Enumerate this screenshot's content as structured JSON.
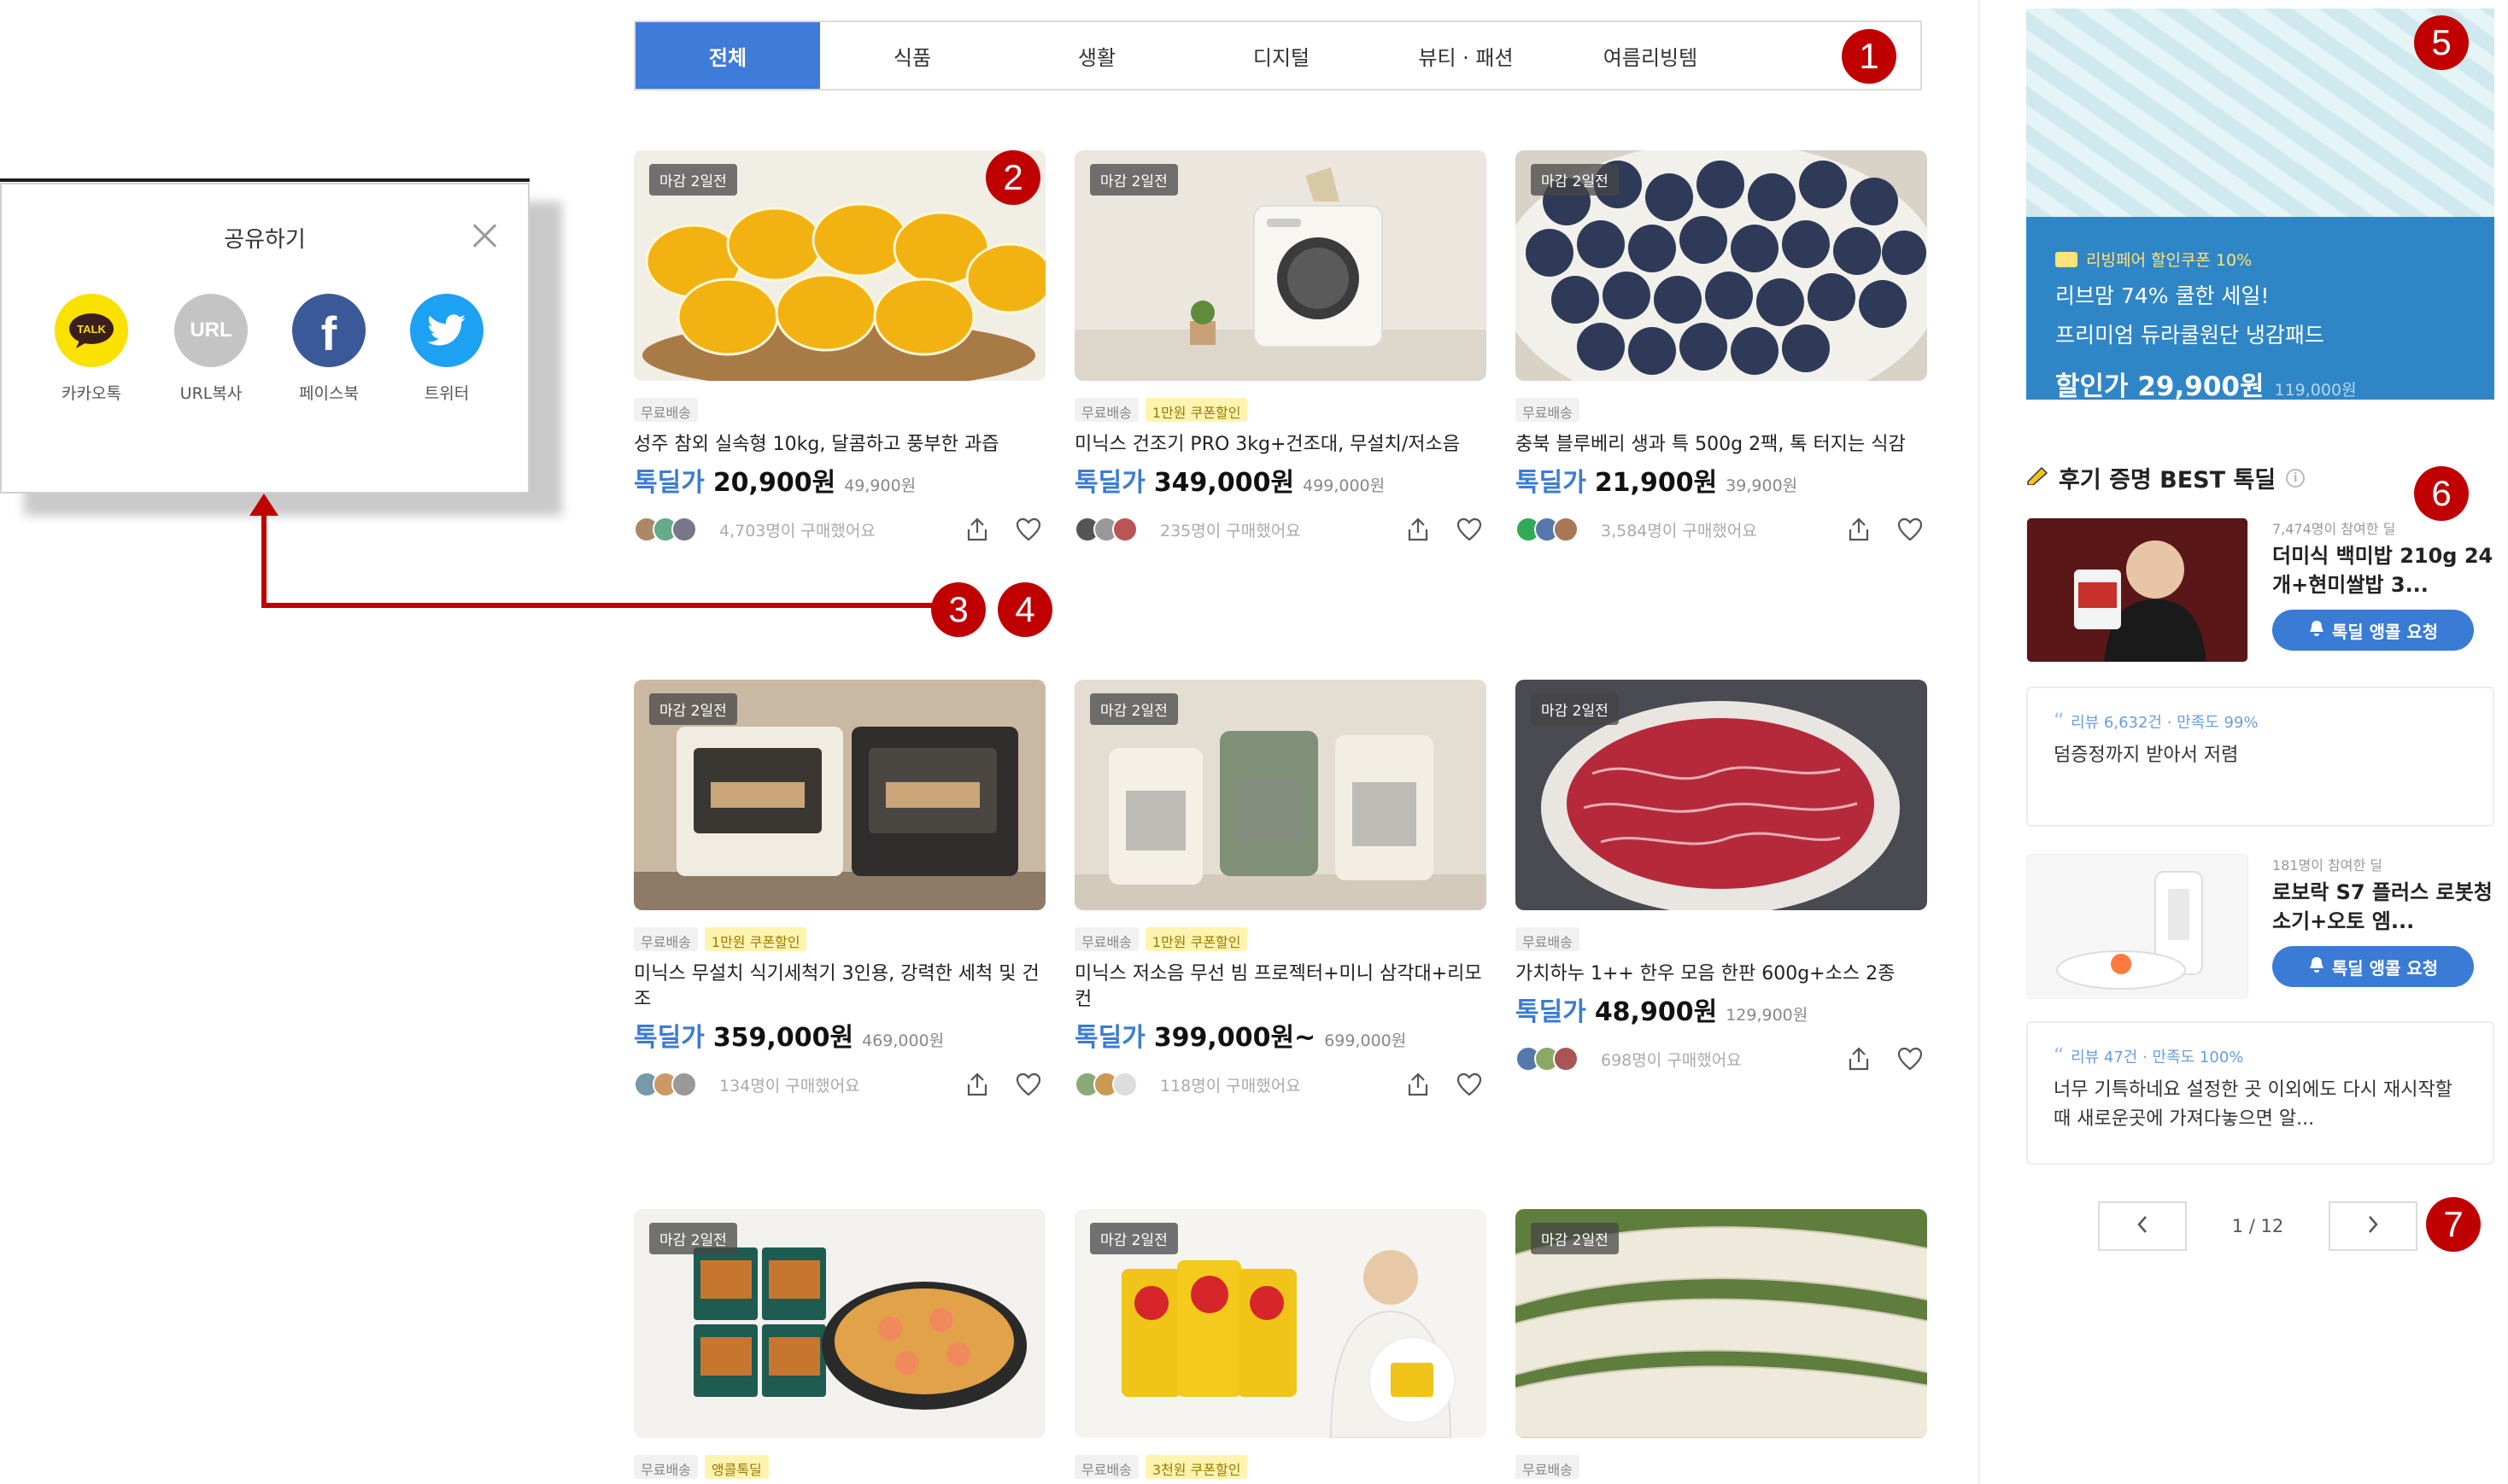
{
  "tabs": [
    {
      "label": "전체",
      "active": true
    },
    {
      "label": "식품",
      "active": false
    },
    {
      "label": "생활",
      "active": false
    },
    {
      "label": "디지털",
      "active": false
    },
    {
      "label": "뷰티 · 패션",
      "active": false
    },
    {
      "label": "여름리빙템",
      "active": false
    }
  ],
  "share": {
    "title": "공유하기",
    "buttons": [
      {
        "label": "카카오톡",
        "icon": "kakaotalk-icon",
        "color": "#fae100",
        "glyph": "TALK"
      },
      {
        "label": "URL복사",
        "icon": "url-copy-icon",
        "color": "#c4c4c4",
        "glyph": "URL"
      },
      {
        "label": "페이스북",
        "icon": "facebook-icon",
        "color": "#3b5998",
        "glyph": "f"
      },
      {
        "label": "트위터",
        "icon": "twitter-icon",
        "color": "#1da1f2",
        "glyph": ""
      }
    ]
  },
  "markers": [
    "1",
    "2",
    "3",
    "4",
    "5",
    "6",
    "7"
  ],
  "products": [
    {
      "deadline": "마감 2일전",
      "tags": [
        "무료배송"
      ],
      "name": "성주 참외 실속형 10kg, 달콤하고 풍부한 과즙",
      "price_label": "톡딜가",
      "price": "20,900원",
      "original": "49,900원",
      "buyers": "4,703명이 구매했어요"
    },
    {
      "deadline": "마감 2일전",
      "tags": [
        "무료배송",
        "1만원 쿠폰할인"
      ],
      "name": "미닉스 건조기 PRO 3kg+건조대, 무설치/저소음",
      "price_label": "톡딜가",
      "price": "349,000원",
      "original": "499,000원",
      "buyers": "235명이 구매했어요"
    },
    {
      "deadline": "마감 2일전",
      "tags": [
        "무료배송"
      ],
      "name": "충북 블루베리 생과 특 500g 2팩, 톡 터지는 식감",
      "price_label": "톡딜가",
      "price": "21,900원",
      "original": "39,900원",
      "buyers": "3,584명이 구매했어요"
    },
    {
      "deadline": "마감 2일전",
      "tags": [
        "무료배송",
        "1만원 쿠폰할인"
      ],
      "name": "미닉스 무설치 식기세척기 3인용, 강력한 세척 및 건조",
      "price_label": "톡딜가",
      "price": "359,000원",
      "original": "469,000원",
      "buyers": "134명이 구매했어요"
    },
    {
      "deadline": "마감 2일전",
      "tags": [
        "무료배송",
        "1만원 쿠폰할인"
      ],
      "name": "미닉스 저소음 무선 빔 프로젝터+미니 삼각대+리모컨",
      "price_label": "톡딜가",
      "price": "399,000원~",
      "original": "699,000원",
      "buyers": "118명이 구매했어요"
    },
    {
      "deadline": "마감 2일전",
      "tags": [
        "무료배송"
      ],
      "name": "가치하누 1++ 한우 모음 한판 600g+소스 2종",
      "price_label": "톡딜가",
      "price": "48,900원",
      "original": "129,900원",
      "buyers": "698명이 구매했어요"
    },
    {
      "deadline": "마감 2일전",
      "tags": [
        "무료배송",
        "앵콜톡딜"
      ]
    },
    {
      "deadline": "마감 2일전",
      "tags": [
        "무료배송",
        "3천원 쿠폰할인"
      ]
    },
    {
      "deadline": "마감 2일전",
      "tags": [
        "무료배송"
      ]
    }
  ],
  "ad": {
    "coupon": "리빙페어 할인쿠폰 10%",
    "line1": "리브맘 74% 쿨한 세일!",
    "line2": "프리미엄 듀라쿨원단 냉감패드",
    "price": "할인가 29,900원",
    "original": "119,000원"
  },
  "best": {
    "title": "후기 증명 BEST 톡딜",
    "items": [
      {
        "count": "7,474명이 참여한 딜",
        "name": "더미식 백미밥 210g 24개+현미쌀밥 3...",
        "button": "톡딜 앵콜 요청",
        "review_head": "리뷰 6,632건 · 만족도 99%",
        "review_text": "덤증정까지 받아서 저렴"
      },
      {
        "count": "181명이 참여한 딜",
        "name": "로보락 S7 플러스 로봇청소기+오토 엠...",
        "button": "톡딜 앵콜 요청",
        "review_head": "리뷰 47건 · 만족도 100%",
        "review_text": "너무 기특하네요 설정한 곳 이외에도 다시 재시작할때 새로운곳에 가져다놓으면 알..."
      }
    ],
    "pager": "1 / 12"
  }
}
